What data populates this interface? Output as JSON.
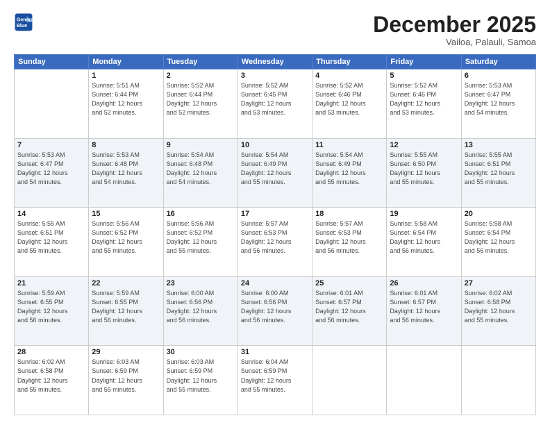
{
  "header": {
    "logo_line1": "General",
    "logo_line2": "Blue",
    "month": "December 2025",
    "location": "Vailoa, Palauli, Samoa"
  },
  "weekdays": [
    "Sunday",
    "Monday",
    "Tuesday",
    "Wednesday",
    "Thursday",
    "Friday",
    "Saturday"
  ],
  "weeks": [
    [
      {
        "day": "",
        "info": ""
      },
      {
        "day": "1",
        "info": "Sunrise: 5:51 AM\nSunset: 6:44 PM\nDaylight: 12 hours\nand 52 minutes."
      },
      {
        "day": "2",
        "info": "Sunrise: 5:52 AM\nSunset: 6:44 PM\nDaylight: 12 hours\nand 52 minutes."
      },
      {
        "day": "3",
        "info": "Sunrise: 5:52 AM\nSunset: 6:45 PM\nDaylight: 12 hours\nand 53 minutes."
      },
      {
        "day": "4",
        "info": "Sunrise: 5:52 AM\nSunset: 6:46 PM\nDaylight: 12 hours\nand 53 minutes."
      },
      {
        "day": "5",
        "info": "Sunrise: 5:52 AM\nSunset: 6:46 PM\nDaylight: 12 hours\nand 53 minutes."
      },
      {
        "day": "6",
        "info": "Sunrise: 5:53 AM\nSunset: 6:47 PM\nDaylight: 12 hours\nand 54 minutes."
      }
    ],
    [
      {
        "day": "7",
        "info": "Sunrise: 5:53 AM\nSunset: 6:47 PM\nDaylight: 12 hours\nand 54 minutes."
      },
      {
        "day": "8",
        "info": "Sunrise: 5:53 AM\nSunset: 6:48 PM\nDaylight: 12 hours\nand 54 minutes."
      },
      {
        "day": "9",
        "info": "Sunrise: 5:54 AM\nSunset: 6:48 PM\nDaylight: 12 hours\nand 54 minutes."
      },
      {
        "day": "10",
        "info": "Sunrise: 5:54 AM\nSunset: 6:49 PM\nDaylight: 12 hours\nand 55 minutes."
      },
      {
        "day": "11",
        "info": "Sunrise: 5:54 AM\nSunset: 6:49 PM\nDaylight: 12 hours\nand 55 minutes."
      },
      {
        "day": "12",
        "info": "Sunrise: 5:55 AM\nSunset: 6:50 PM\nDaylight: 12 hours\nand 55 minutes."
      },
      {
        "day": "13",
        "info": "Sunrise: 5:55 AM\nSunset: 6:51 PM\nDaylight: 12 hours\nand 55 minutes."
      }
    ],
    [
      {
        "day": "14",
        "info": "Sunrise: 5:55 AM\nSunset: 6:51 PM\nDaylight: 12 hours\nand 55 minutes."
      },
      {
        "day": "15",
        "info": "Sunrise: 5:56 AM\nSunset: 6:52 PM\nDaylight: 12 hours\nand 55 minutes."
      },
      {
        "day": "16",
        "info": "Sunrise: 5:56 AM\nSunset: 6:52 PM\nDaylight: 12 hours\nand 55 minutes."
      },
      {
        "day": "17",
        "info": "Sunrise: 5:57 AM\nSunset: 6:53 PM\nDaylight: 12 hours\nand 56 minutes."
      },
      {
        "day": "18",
        "info": "Sunrise: 5:57 AM\nSunset: 6:53 PM\nDaylight: 12 hours\nand 56 minutes."
      },
      {
        "day": "19",
        "info": "Sunrise: 5:58 AM\nSunset: 6:54 PM\nDaylight: 12 hours\nand 56 minutes."
      },
      {
        "day": "20",
        "info": "Sunrise: 5:58 AM\nSunset: 6:54 PM\nDaylight: 12 hours\nand 56 minutes."
      }
    ],
    [
      {
        "day": "21",
        "info": "Sunrise: 5:59 AM\nSunset: 6:55 PM\nDaylight: 12 hours\nand 56 minutes."
      },
      {
        "day": "22",
        "info": "Sunrise: 5:59 AM\nSunset: 6:55 PM\nDaylight: 12 hours\nand 56 minutes."
      },
      {
        "day": "23",
        "info": "Sunrise: 6:00 AM\nSunset: 6:56 PM\nDaylight: 12 hours\nand 56 minutes."
      },
      {
        "day": "24",
        "info": "Sunrise: 6:00 AM\nSunset: 6:56 PM\nDaylight: 12 hours\nand 56 minutes."
      },
      {
        "day": "25",
        "info": "Sunrise: 6:01 AM\nSunset: 6:57 PM\nDaylight: 12 hours\nand 56 minutes."
      },
      {
        "day": "26",
        "info": "Sunrise: 6:01 AM\nSunset: 6:57 PM\nDaylight: 12 hours\nand 56 minutes."
      },
      {
        "day": "27",
        "info": "Sunrise: 6:02 AM\nSunset: 6:58 PM\nDaylight: 12 hours\nand 55 minutes."
      }
    ],
    [
      {
        "day": "28",
        "info": "Sunrise: 6:02 AM\nSunset: 6:58 PM\nDaylight: 12 hours\nand 55 minutes."
      },
      {
        "day": "29",
        "info": "Sunrise: 6:03 AM\nSunset: 6:59 PM\nDaylight: 12 hours\nand 55 minutes."
      },
      {
        "day": "30",
        "info": "Sunrise: 6:03 AM\nSunset: 6:59 PM\nDaylight: 12 hours\nand 55 minutes."
      },
      {
        "day": "31",
        "info": "Sunrise: 6:04 AM\nSunset: 6:59 PM\nDaylight: 12 hours\nand 55 minutes."
      },
      {
        "day": "",
        "info": ""
      },
      {
        "day": "",
        "info": ""
      },
      {
        "day": "",
        "info": ""
      }
    ]
  ]
}
